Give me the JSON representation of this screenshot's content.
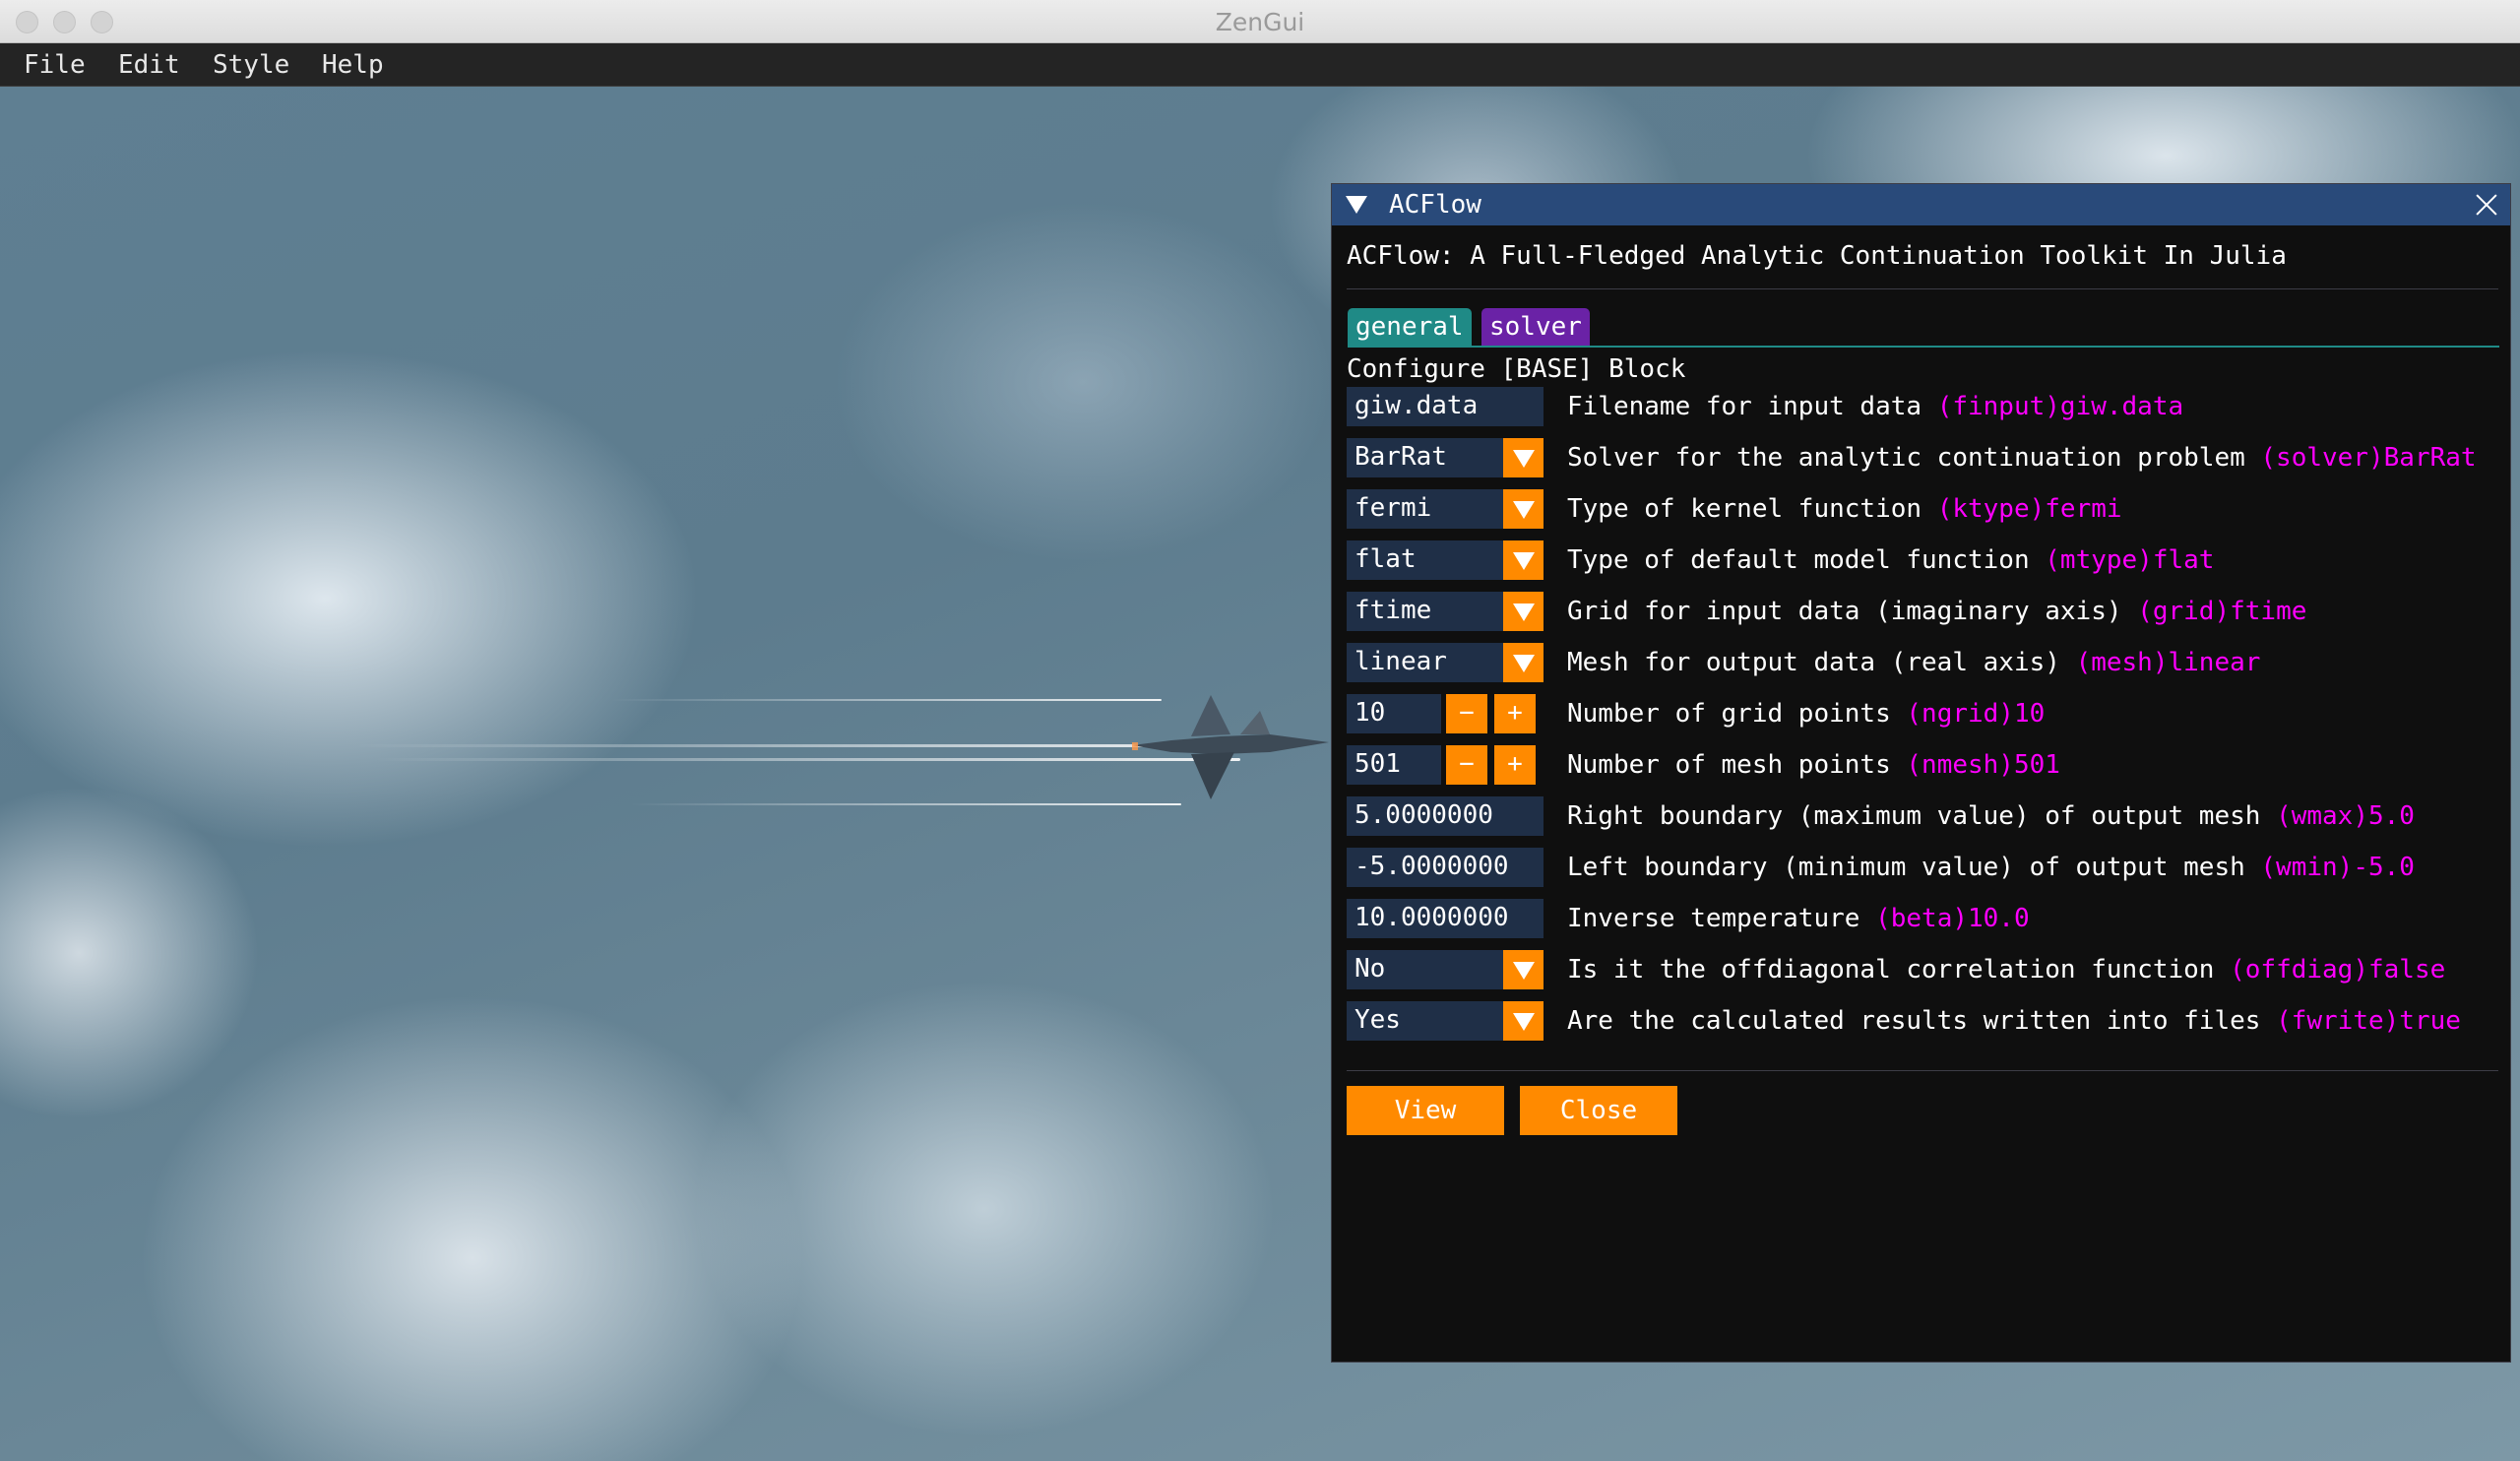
{
  "window": {
    "title": "ZenGui"
  },
  "menu": [
    "File",
    "Edit",
    "Style",
    "Help"
  ],
  "panel": {
    "title": "ACFlow",
    "heading": "ACFlow: A Full-Fledged Analytic Continuation Toolkit In Julia",
    "tabs": [
      {
        "label": "general",
        "color": "#1f8a86"
      },
      {
        "label": "solver",
        "color": "#6a22a6"
      }
    ],
    "section_title": "Configure [BASE] Block",
    "rows": [
      {
        "widget": "input",
        "value": "giw.data",
        "description": "Filename for input data",
        "key": "(finput)giw.data"
      },
      {
        "widget": "combo",
        "value": "BarRat",
        "description": "Solver for the analytic continuation problem",
        "key": "(solver)BarRat"
      },
      {
        "widget": "combo",
        "value": "fermi",
        "description": "Type of kernel function",
        "key": "(ktype)fermi"
      },
      {
        "widget": "combo",
        "value": "flat",
        "description": "Type of default model function",
        "key": "(mtype)flat"
      },
      {
        "widget": "combo",
        "value": "ftime",
        "description": "Grid for input data (imaginary axis)",
        "key": "(grid)ftime"
      },
      {
        "widget": "combo",
        "value": "linear",
        "description": "Mesh for output data (real axis)",
        "key": "(mesh)linear"
      },
      {
        "widget": "stepper",
        "value": "10",
        "description": "Number of grid points",
        "key": "(ngrid)10"
      },
      {
        "widget": "stepper",
        "value": "501",
        "description": "Number of mesh points",
        "key": "(nmesh)501"
      },
      {
        "widget": "input",
        "value": "5.0000000",
        "description": "Right boundary (maximum value) of output mesh",
        "key": "(wmax)5.0"
      },
      {
        "widget": "input",
        "value": "-5.0000000",
        "description": "Left boundary (minimum value) of output mesh",
        "key": "(wmin)-5.0"
      },
      {
        "widget": "input",
        "value": "10.0000000",
        "description": "Inverse temperature",
        "key": "(beta)10.0"
      },
      {
        "widget": "combo",
        "value": "No",
        "description": "Is it the offdiagonal correlation function",
        "key": "(offdiag)false"
      },
      {
        "widget": "combo",
        "value": "Yes",
        "description": "Are the calculated results written into files",
        "key": "(fwrite)true"
      }
    ],
    "stepper_minus": "−",
    "stepper_plus": "+",
    "buttons": {
      "view": "View",
      "close": "Close"
    }
  },
  "colors": {
    "accent": "#ff8a00",
    "key_text": "#ff00ff",
    "title_bar": "#294a7a",
    "widget_bg": "#1f2f47"
  },
  "icons": [
    "collapse-triangle-icon",
    "close-icon",
    "dropdown-arrow-icon",
    "minus-icon",
    "plus-icon"
  ]
}
